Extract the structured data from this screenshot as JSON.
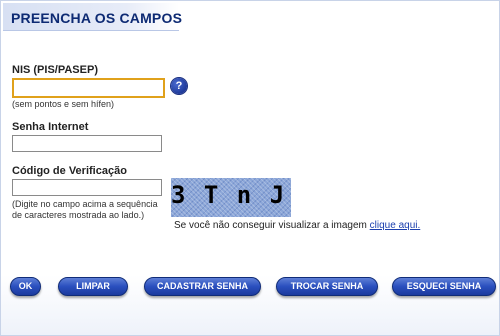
{
  "header": {
    "title": "PREENCHA OS CAMPOS"
  },
  "nis": {
    "label": "NIS (PIS/PASEP)",
    "value": "",
    "hint": "(sem pontos e sem hífen)",
    "help_icon": "question-icon",
    "help_glyph": "?"
  },
  "senha": {
    "label": "Senha Internet",
    "value": ""
  },
  "codigo": {
    "label": "Código de Verificação",
    "value": "",
    "hint_line1": "(Digite no campo acima a sequência",
    "hint_line2": "de caracteres mostrada ao lado.)",
    "captcha_text": "3 T n J",
    "noimage_text": "Se você não conseguir visualizar a imagem",
    "noimage_link": "clique aqui."
  },
  "buttons": {
    "ok": "OK",
    "limpar": "LIMPAR",
    "cadastrar": "CADASTRAR SENHA",
    "trocar": "TROCAR SENHA",
    "esqueci": "ESQUECI SENHA"
  },
  "colors": {
    "header_text": "#0d2a73",
    "button": "#2a4fbe",
    "focus_border": "#e0a11b",
    "link": "#1b3fae"
  }
}
